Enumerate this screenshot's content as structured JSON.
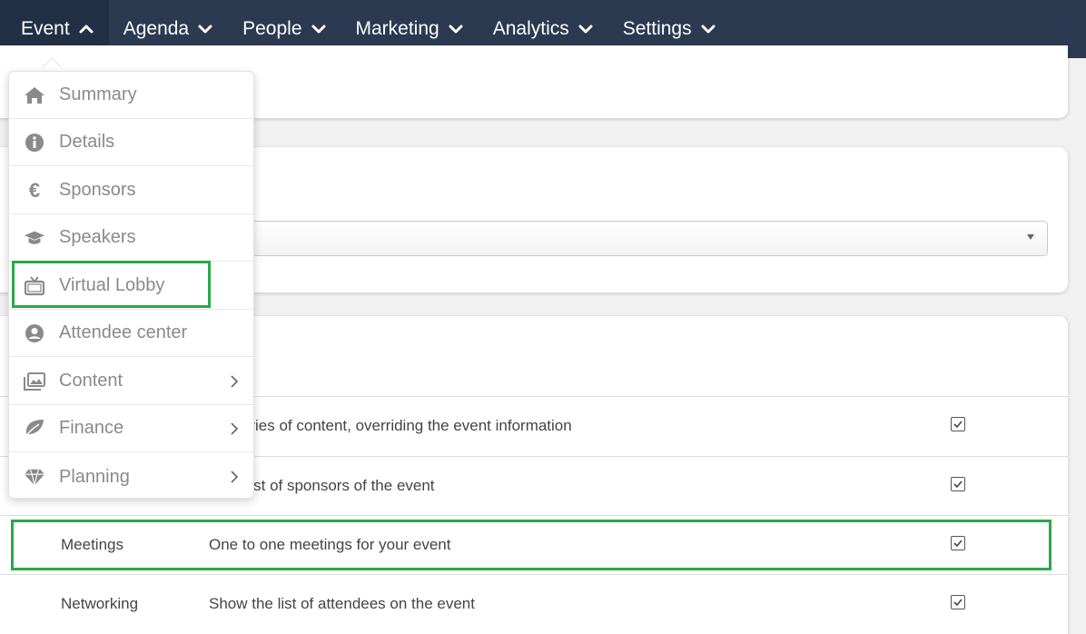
{
  "nav": {
    "items": [
      {
        "label": "Event",
        "expanded": true
      },
      {
        "label": "Agenda",
        "expanded": false
      },
      {
        "label": "People",
        "expanded": false
      },
      {
        "label": "Marketing",
        "expanded": false
      },
      {
        "label": "Analytics",
        "expanded": false
      },
      {
        "label": "Settings",
        "expanded": false
      }
    ]
  },
  "event_menu": {
    "items": [
      {
        "label": "Summary",
        "icon": "home-icon"
      },
      {
        "label": "Details",
        "icon": "info-icon"
      },
      {
        "label": "Sponsors",
        "icon": "euro-icon"
      },
      {
        "label": "Speakers",
        "icon": "graduation-cap-icon"
      },
      {
        "label": "Virtual Lobby",
        "icon": "tv-icon"
      },
      {
        "label": "Attendee center",
        "icon": "user-circle-icon"
      },
      {
        "label": "Content",
        "icon": "images-icon",
        "submenu": true
      },
      {
        "label": "Finance",
        "icon": "leaf-icon",
        "submenu": true
      },
      {
        "label": "Planning",
        "icon": "gem-icon",
        "submenu": true
      }
    ]
  },
  "features_table": {
    "rows": [
      {
        "name": "",
        "description": "y a series of content, overriding the event information",
        "checked": true
      },
      {
        "name": "",
        "description": "y the list of sponsors of the event",
        "checked": true
      },
      {
        "name": "Meetings",
        "description": "One to one meetings for your event",
        "checked": true
      },
      {
        "name": "Networking",
        "description": "Show the list of attendees on the event",
        "checked": true
      }
    ]
  },
  "colors": {
    "nav_bg": "#2b3a50",
    "highlight": "#2aa84a",
    "menu_text": "#8a8a8a"
  }
}
